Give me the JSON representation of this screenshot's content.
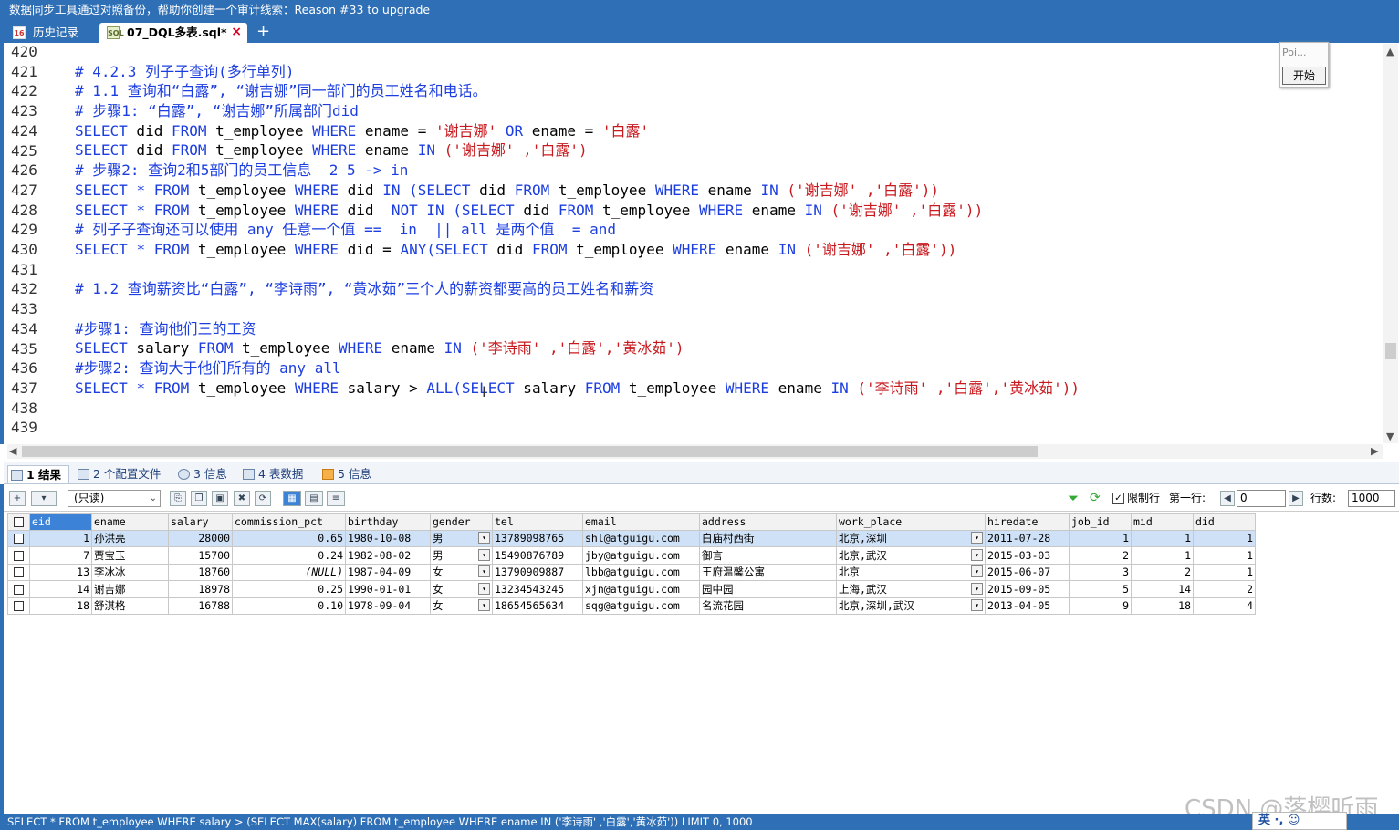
{
  "window": {
    "title": "数据同步工具通过对照备份，帮助你创建一个审计线索：Reason #33 to upgrade"
  },
  "tabs": {
    "history": "历史记录",
    "sql_file": "07_DQL多表.sql*",
    "close": "×",
    "add": "+",
    "history_icon": "16",
    "sql_icon": "SQL"
  },
  "editor": {
    "line_numbers": [
      "420",
      "421",
      "422",
      "423",
      "424",
      "425",
      "426",
      "427",
      "428",
      "429",
      "430",
      "431",
      "432",
      "433",
      "434",
      "435",
      "436",
      "437",
      "438",
      "439"
    ]
  },
  "panel": {
    "poi": "Poi...",
    "start": "开始"
  },
  "result_tabs": [
    {
      "label": "1 结果"
    },
    {
      "label": "2 个配置文件"
    },
    {
      "label": "3 信息"
    },
    {
      "label": "4 表数据"
    },
    {
      "label": "5 信息"
    }
  ],
  "toolbar": {
    "mode": "(只读)",
    "limit_label": "限制行",
    "first_row_label": "第一行:",
    "first_row_value": "0",
    "rows_label": "行数:",
    "rows_value": "1000"
  },
  "grid": {
    "columns": [
      "eid",
      "ename",
      "salary",
      "commission_pct",
      "birthday",
      "gender",
      "tel",
      "email",
      "address",
      "work_place",
      "hiredate",
      "job_id",
      "mid",
      "did"
    ],
    "rows": [
      [
        "1",
        "孙洪亮",
        "28000",
        "0.65",
        "1980-10-08",
        "男",
        "13789098765",
        "shl@atguigu.com",
        "白庙村西街",
        "北京,深圳",
        "2011-07-28",
        "1",
        "1",
        "1"
      ],
      [
        "7",
        "贾宝玉",
        "15700",
        "0.24",
        "1982-08-02",
        "男",
        "15490876789",
        "jby@atguigu.com",
        "御言",
        "北京,武汉",
        "2015-03-03",
        "2",
        "1",
        "1"
      ],
      [
        "13",
        "李冰冰",
        "18760",
        "(NULL)",
        "1987-04-09",
        "女",
        "13790909887",
        "lbb@atguigu.com",
        "王府温馨公寓",
        "北京",
        "2015-06-07",
        "3",
        "2",
        "1"
      ],
      [
        "14",
        "谢吉娜",
        "18978",
        "0.25",
        "1990-01-01",
        "女",
        "13234543245",
        "xjn@atguigu.com",
        "园中园",
        "上海,武汉",
        "2015-09-05",
        "5",
        "14",
        "2"
      ],
      [
        "18",
        "舒淇格",
        "16788",
        "0.10",
        "1978-09-04",
        "女",
        "18654565634",
        "sqg@atguigu.com",
        "名流花园",
        "北京,深圳,武汉",
        "2013-04-05",
        "9",
        "18",
        "4"
      ]
    ]
  },
  "status": {
    "sql": "SELECT * FROM t_employee WHERE salary > (SELECT MAX(salary) FROM t_employee WHERE ename IN ('李诗雨' ,'白露','黄冰茹')) LIMIT 0, 1000"
  },
  "ime": "英 ·, ☺",
  "watermark": "CSDN @落樱听雨",
  "colors": {
    "accent": "#2f6fb5",
    "keyword": "#1c3ee0",
    "string": "#c8191e"
  }
}
